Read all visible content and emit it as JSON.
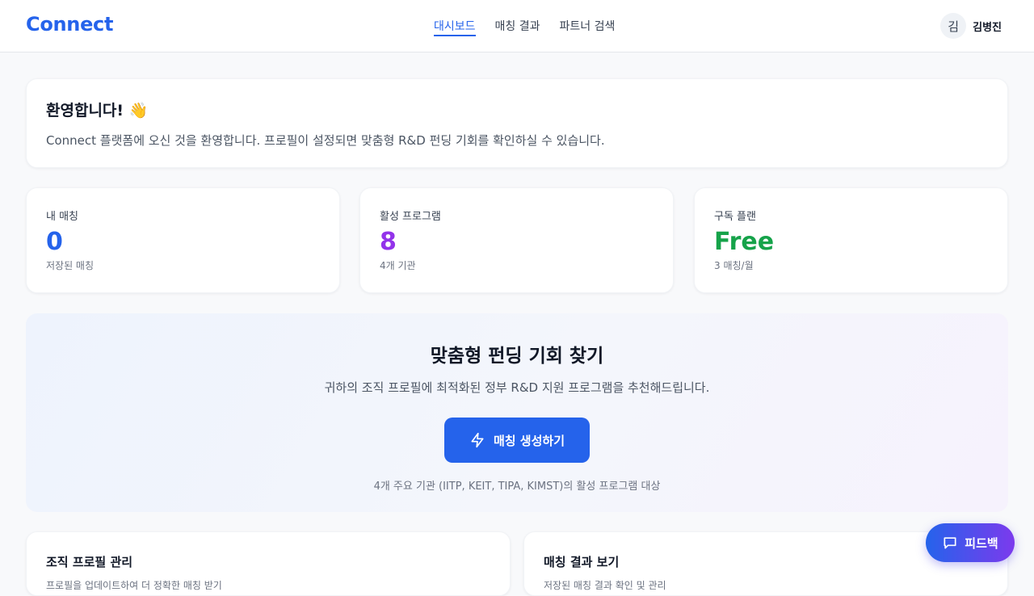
{
  "app": {
    "logo": "Connect"
  },
  "nav": {
    "items": [
      {
        "label": "대시보드",
        "active": true
      },
      {
        "label": "매칭 결과",
        "active": false
      },
      {
        "label": "파트너 검색",
        "active": false
      }
    ]
  },
  "user": {
    "avatar_initial": "김",
    "name": "김병진"
  },
  "welcome": {
    "title": "환영합니다! 👋",
    "text": "Connect 플랫폼에 오신 것을 환영합니다. 프로필이 설정되면 맞춤형 R&D 펀딩 기회를 확인하실 수 있습니다."
  },
  "stats": [
    {
      "label": "내 매칭",
      "value": "0",
      "sub": "저장된 매칭",
      "color": "#2563eb"
    },
    {
      "label": "활성 프로그램",
      "value": "8",
      "sub": "4개 기관",
      "color": "#9333ea"
    },
    {
      "label": "구독 플랜",
      "value": "Free",
      "sub": "3 매칭/월",
      "color": "#16a34a"
    }
  ],
  "cta": {
    "title": "맞춤형 펀딩 기회 찾기",
    "text": "귀하의 조직 프로필에 최적화된 정부 R&D 지원 프로그램을 추천해드립니다.",
    "button_label": "매칭 생성하기",
    "button_icon": "lightning-icon",
    "note": "4개 주요 기관 (IITP, KEIT, TIPA, KIMST)의 활성 프로그램 대상"
  },
  "bottom_cards": [
    {
      "title": "조직 프로필 관리",
      "sub": "프로필을 업데이트하여 더 정확한 매칭 받기"
    },
    {
      "title": "매칭 결과 보기",
      "sub": "저장된 매칭 결과 확인 및 관리"
    }
  ],
  "feedback": {
    "label": "피드백",
    "icon": "chat-icon"
  },
  "colors": {
    "accent": "#2563eb",
    "purple": "#9333ea",
    "green": "#16a34a"
  }
}
